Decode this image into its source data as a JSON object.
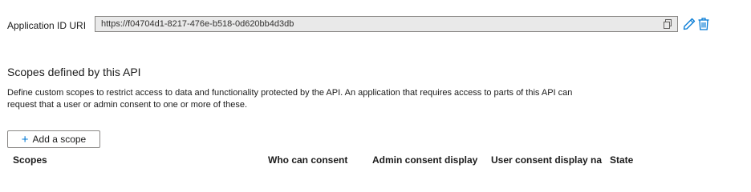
{
  "uri": {
    "label": "Application ID URI",
    "value": "https://f04704d1-8217-476e-b518-0d620bb4d3db"
  },
  "icons": {
    "copy": "copy-icon",
    "edit": "pencil-icon",
    "delete": "trash-icon",
    "add": "plus-icon"
  },
  "colors": {
    "accent": "#0078d4",
    "field_bg": "#e9e9e9",
    "border": "#8a8886"
  },
  "scopes": {
    "title": "Scopes defined by this API",
    "description": "Define custom scopes to restrict access to data and functionality protected by the API. An application that requires access to parts of this API can request that a user or admin consent to one or more of these.",
    "add_button_label": "Add a scope",
    "columns": [
      "Scopes",
      "Who can consent",
      "Admin consent display",
      "User consent display na",
      "State"
    ]
  }
}
